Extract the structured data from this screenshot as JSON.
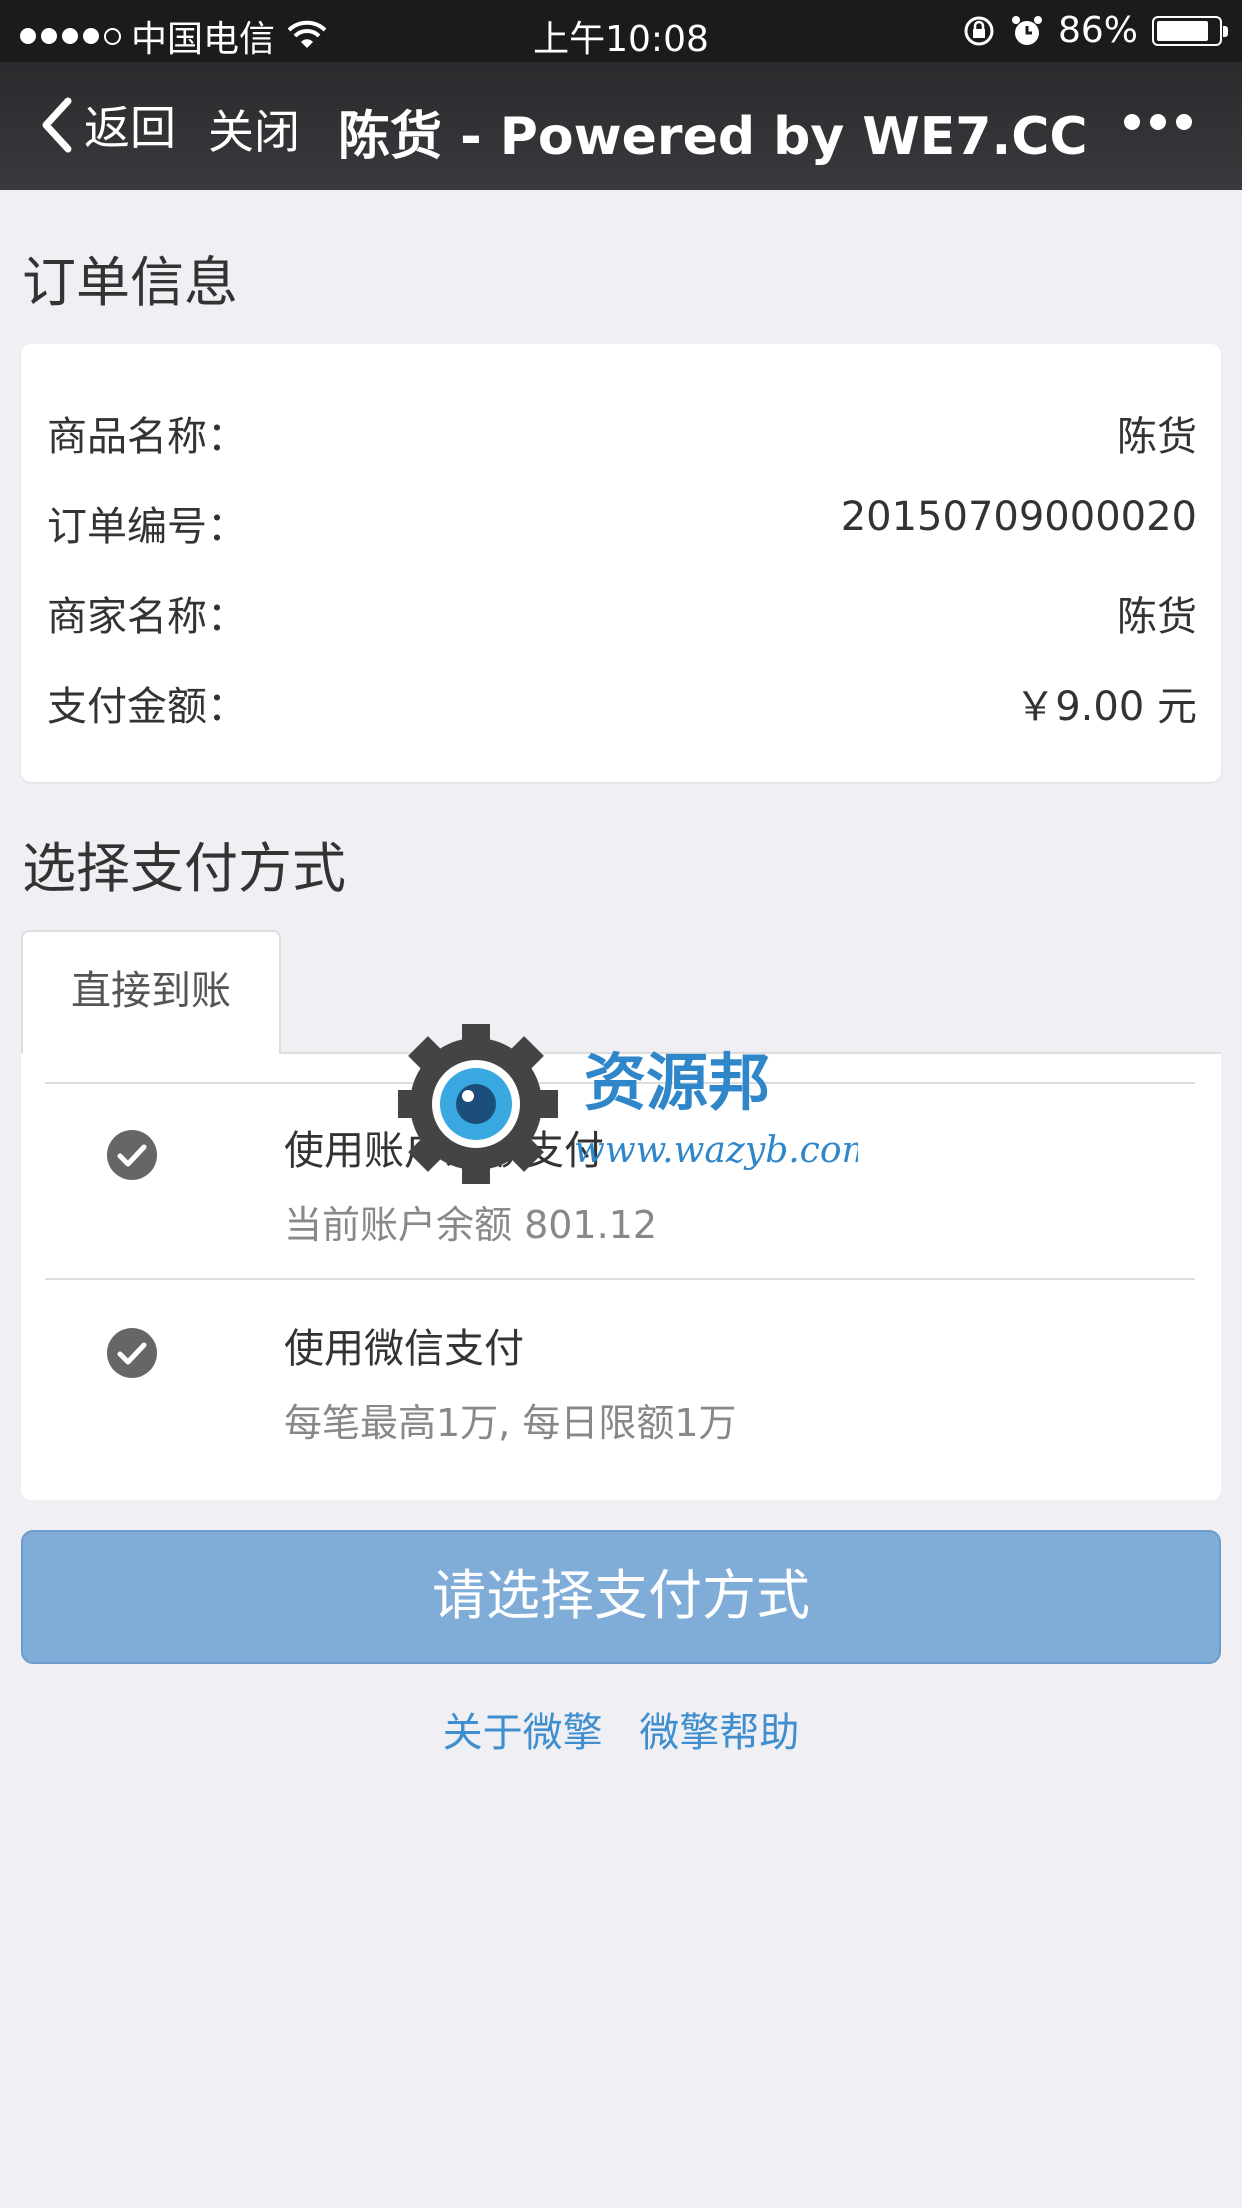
{
  "status_bar": {
    "carrier": "中国电信",
    "time": "上午10:08",
    "battery": "86%",
    "battery_level": 0.86
  },
  "nav": {
    "back_label": "返回",
    "close_label": "关闭",
    "title": "陈货 - Powered by WE7.CC"
  },
  "order": {
    "section_title": "订单信息",
    "rows": [
      {
        "label": "商品名称：",
        "value": "陈货"
      },
      {
        "label": "订单编号：",
        "value": "20150709000020"
      },
      {
        "label": "商家名称：",
        "value": "陈货"
      },
      {
        "label": "支付金额：",
        "value": "￥9.00 元"
      }
    ]
  },
  "payment": {
    "section_title": "选择支付方式",
    "tab_label": "直接到账",
    "methods": [
      {
        "title": "使用账户余额支付",
        "subtitle": "当前账户余额 801.12"
      },
      {
        "title": "使用微信支付",
        "subtitle": "每笔最高1万, 每日限额1万"
      }
    ],
    "submit_label": "请选择支付方式"
  },
  "footer": {
    "links": [
      "关于微擎",
      "微擎帮助"
    ]
  },
  "watermark": {
    "name": "资源邦",
    "url": "www.wazyb.com"
  },
  "colors": {
    "accent": "#7fadd8",
    "link": "#3f8fd0",
    "check": "#666666"
  }
}
